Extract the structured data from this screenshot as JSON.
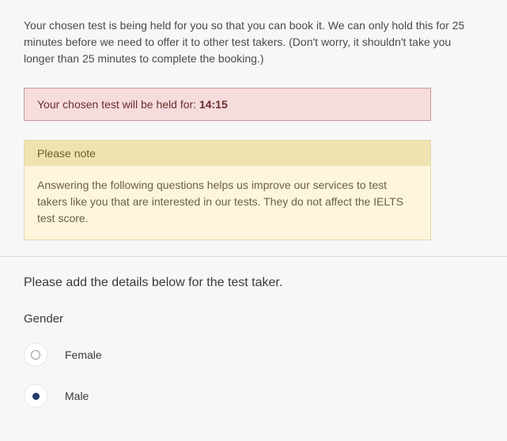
{
  "intro_text": "Your chosen test is being held for you so that you can book it. We can only hold this for 25 minutes before we need to offer it to other test takers. (Don't worry, it shouldn't take you longer than 25 minutes to complete the booking.)",
  "hold": {
    "label": "Your chosen test will be held for: ",
    "time": "14:15"
  },
  "note": {
    "header": "Please note",
    "body": "Answering the following questions helps us improve our services to test takers like you that are interested in our tests. They do not affect the IELTS test score."
  },
  "form": {
    "title": "Please add the details below for the test taker.",
    "gender_label": "Gender",
    "options": {
      "female": "Female",
      "male": "Male"
    },
    "selected": "male"
  }
}
